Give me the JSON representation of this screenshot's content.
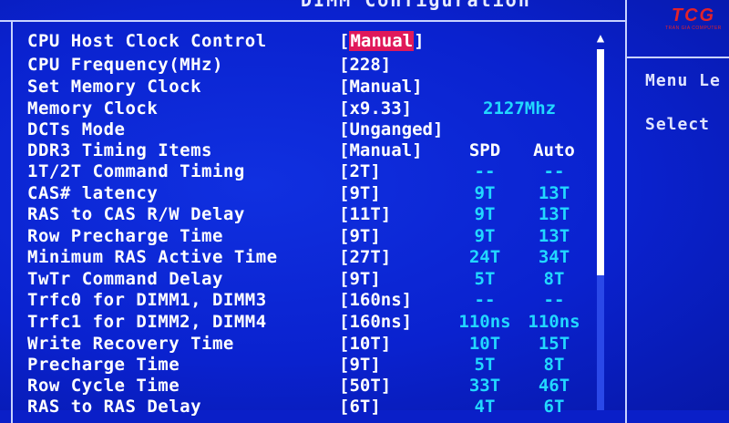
{
  "window": {
    "title": "DIMM Configuration"
  },
  "logo": {
    "text": "TCG",
    "subtext": "TRAN GIA COMPUTER"
  },
  "help_panel": {
    "line1": "Menu Le",
    "line2": "Select"
  },
  "settings": [
    {
      "label": "CPU Host Clock Control",
      "value_pre": "[",
      "value": "Manual",
      "value_post": "]",
      "highlight": true
    },
    {
      "label": "CPU Frequency(MHz)",
      "value": "[228]"
    },
    {
      "label": "Set Memory Clock",
      "value": "[Manual]"
    },
    {
      "label": "Memory Clock",
      "value": "[x9.33]",
      "extra": "2127Mhz"
    },
    {
      "label": "DCTs Mode",
      "value": "[Unganged]"
    },
    {
      "label": "DDR3 Timing Items",
      "value": "[Manual]",
      "spd": "SPD",
      "auto": "Auto",
      "header": true
    },
    {
      "label": "1T/2T Command Timing",
      "value": "[2T]",
      "spd": "--",
      "auto": "--"
    },
    {
      "label": "CAS# latency",
      "value": "[9T]",
      "spd": "9T",
      "auto": "13T"
    },
    {
      "label": "RAS to CAS R/W Delay",
      "value": "[11T]",
      "spd": "9T",
      "auto": "13T"
    },
    {
      "label": "Row Precharge Time",
      "value": "[9T]",
      "spd": "9T",
      "auto": "13T"
    },
    {
      "label": "Minimum RAS Active Time",
      "value": "[27T]",
      "spd": "24T",
      "auto": "34T"
    },
    {
      "label": "TwTr Command Delay",
      "value": "[9T]",
      "spd": "5T",
      "auto": "8T"
    },
    {
      "label": "Trfc0 for DIMM1, DIMM3",
      "value": "[160ns]",
      "spd": "--",
      "auto": "--"
    },
    {
      "label": "Trfc1 for DIMM2, DIMM4",
      "value": "[160ns]",
      "spd": "110ns",
      "auto": "110ns"
    },
    {
      "label": "Write Recovery Time",
      "value": "[10T]",
      "spd": "10T",
      "auto": "15T"
    },
    {
      "label": "Precharge Time",
      "value": "[9T]",
      "spd": "5T",
      "auto": "8T"
    },
    {
      "label": "Row Cycle Time",
      "value": "[50T]",
      "spd": "33T",
      "auto": "46T"
    },
    {
      "label": "RAS to RAS Delay",
      "value": "[6T]",
      "spd": "4T",
      "auto": "6T"
    }
  ],
  "scroll": {
    "up_icon": "▲"
  },
  "colors": {
    "background": "#0a1fc8",
    "value_cyan": "#22d8ff",
    "highlight": "#e0195a",
    "logo_red": "#e3222b"
  }
}
